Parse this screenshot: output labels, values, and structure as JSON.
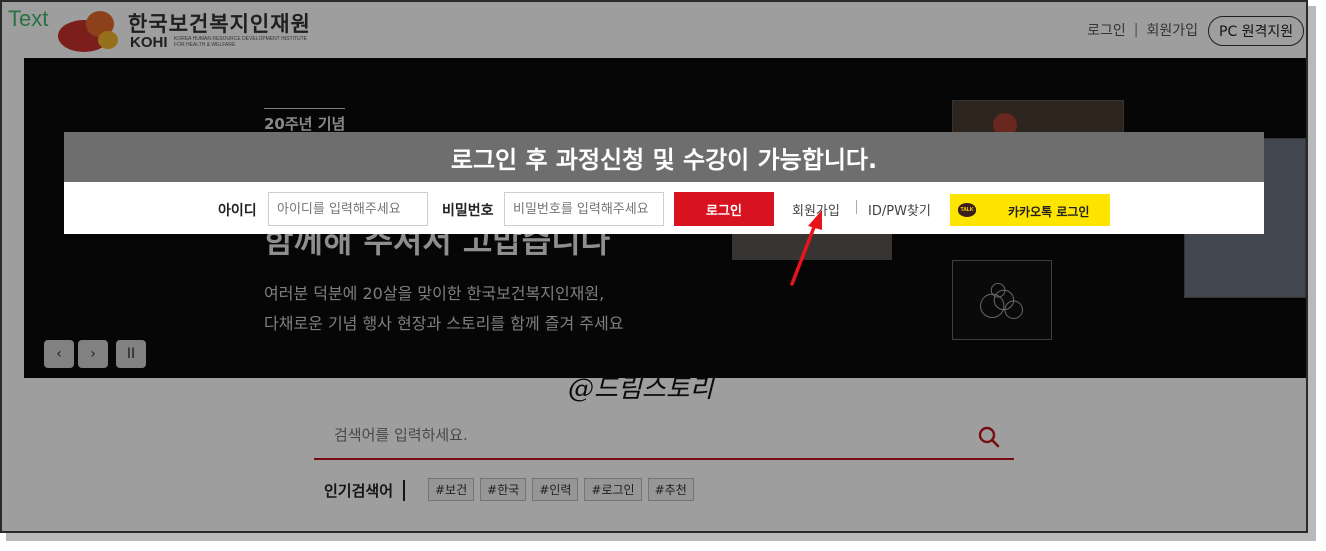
{
  "watermark": "Text",
  "header": {
    "brand_ko": "한국보건복지인재원",
    "brand_en": "KOHI",
    "brand_sub": "KOREA HUMAN RESOURCE DEVELOPMENT INSTITUTE FOR HEALTH & WELFARE",
    "links": [
      "로그인",
      "회원가입"
    ],
    "separator": "|",
    "pc_remote": "PC 원격지원"
  },
  "hero": {
    "anniversary": "20주년 기념",
    "headline": "함께해 주셔서 고맙습니다",
    "desc_line1": "여러분 덕분에 20살을 맞이한 한국보건복지인재원,",
    "desc_line2": "다채로운 기념 행사 현장과 스토리를 함께 즐겨 주세요",
    "controls": {
      "prev": "‹",
      "next": "›",
      "pause": "II"
    }
  },
  "login_popup": {
    "title": "로그인 후 과정신청 및 수강이 가능합니다.",
    "id_label": "아이디",
    "id_placeholder": "아이디를 입력해주세요",
    "pw_label": "비밀번호",
    "pw_placeholder": "비밀번호를 입력해주세요",
    "login_button": "로그인",
    "join_link": "회원가입",
    "find_link": "ID/PW찾기",
    "kakao_icon_text": "TALK",
    "kakao_button": "카카오톡 로그인"
  },
  "annotation": {
    "signature": "@드림스토리",
    "arrow_color": "#e8141c"
  },
  "search": {
    "placeholder": "검색어를 입력하세요.",
    "popular_label": "인기검색어",
    "tags": [
      "#보건",
      "#한국",
      "#인력",
      "#로그인",
      "#추천"
    ]
  },
  "colors": {
    "brand_red": "#d7131f",
    "kakao_yellow": "#fee500"
  }
}
